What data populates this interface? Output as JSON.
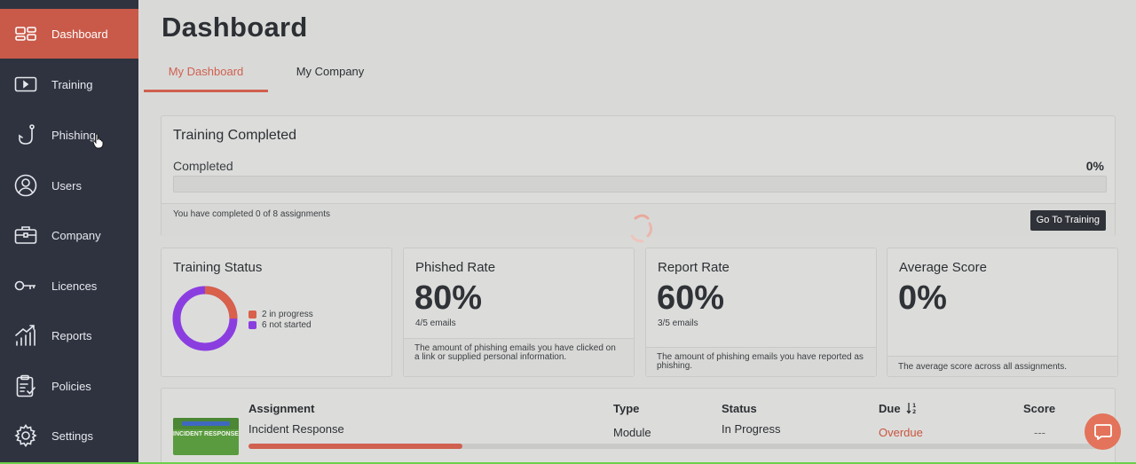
{
  "sidebar": {
    "items": [
      {
        "label": "Dashboard",
        "icon": "dashboard-icon",
        "active": true
      },
      {
        "label": "Training",
        "icon": "video-icon"
      },
      {
        "label": "Phishing",
        "icon": "fishhook-icon"
      },
      {
        "label": "Users",
        "icon": "user-circle-icon"
      },
      {
        "label": "Company",
        "icon": "briefcase-icon"
      },
      {
        "label": "Licences",
        "icon": "key-icon"
      },
      {
        "label": "Reports",
        "icon": "chart-up-icon"
      },
      {
        "label": "Policies",
        "icon": "clipboard-check-icon"
      },
      {
        "label": "Settings",
        "icon": "gear-icon"
      }
    ]
  },
  "header": {
    "title": "Dashboard",
    "tabs": [
      {
        "label": "My Dashboard",
        "active": true
      },
      {
        "label": "My Company"
      }
    ]
  },
  "training_completed": {
    "title": "Training Completed",
    "label": "Completed",
    "percent_text": "0%",
    "progress": 0,
    "note": "You have completed 0 of 8 assignments",
    "button": "Go To Training"
  },
  "stats": {
    "training_status": {
      "title": "Training Status",
      "in_progress": 2,
      "not_started": 6,
      "legend": [
        "2 in progress",
        "6 not started"
      ],
      "colors": {
        "in_progress": "#d9604a",
        "not_started": "#8b3ee0"
      }
    },
    "phished_rate": {
      "title": "Phished Rate",
      "value": "80%",
      "sub": "4/5 emails",
      "desc": "The amount of phishing emails you have clicked on a link or supplied personal information."
    },
    "report_rate": {
      "title": "Report Rate",
      "value": "60%",
      "sub": "3/5 emails",
      "desc": "The amount of phishing emails you have reported as phishing."
    },
    "average_score": {
      "title": "Average Score",
      "value": "0%",
      "desc": "The average score across all assignments."
    }
  },
  "assignments": {
    "headers": {
      "assignment": "Assignment",
      "type": "Type",
      "status": "Status",
      "due": "Due",
      "score": "Score"
    },
    "rows": [
      {
        "name": "Incident Response",
        "thumb_text": "INCIDENT RESPONSE",
        "type": "Module",
        "status": "In Progress",
        "due": "Overdue",
        "score": "---",
        "progress": 0.25
      }
    ]
  },
  "colors": {
    "accent": "#d0604f",
    "sidebar": "#2f3340",
    "help": "#e3735a"
  }
}
